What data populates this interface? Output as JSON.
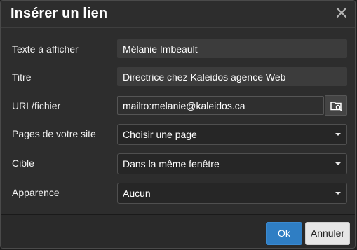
{
  "dialog": {
    "title": "Insérer un lien",
    "close_icon": "close-icon"
  },
  "form": {
    "text": {
      "label": "Texte à afficher",
      "value": "Mélanie Imbeault"
    },
    "title": {
      "label": "Titre",
      "value": "Directrice chez Kaleidos agence Web"
    },
    "url": {
      "label": "URL/fichier",
      "value": "mailto:melanie@kaleidos.ca",
      "browse_icon": "folder-search-icon"
    },
    "pages": {
      "label": "Pages de votre site",
      "selected": "Choisir une page"
    },
    "target": {
      "label": "Cible",
      "selected": "Dans la même fenêtre"
    },
    "appearance": {
      "label": "Apparence",
      "selected": "Aucun"
    }
  },
  "footer": {
    "ok_label": "Ok",
    "cancel_label": "Annuler"
  },
  "colors": {
    "accent": "#2f7ec4",
    "background": "#2d2d2d"
  }
}
